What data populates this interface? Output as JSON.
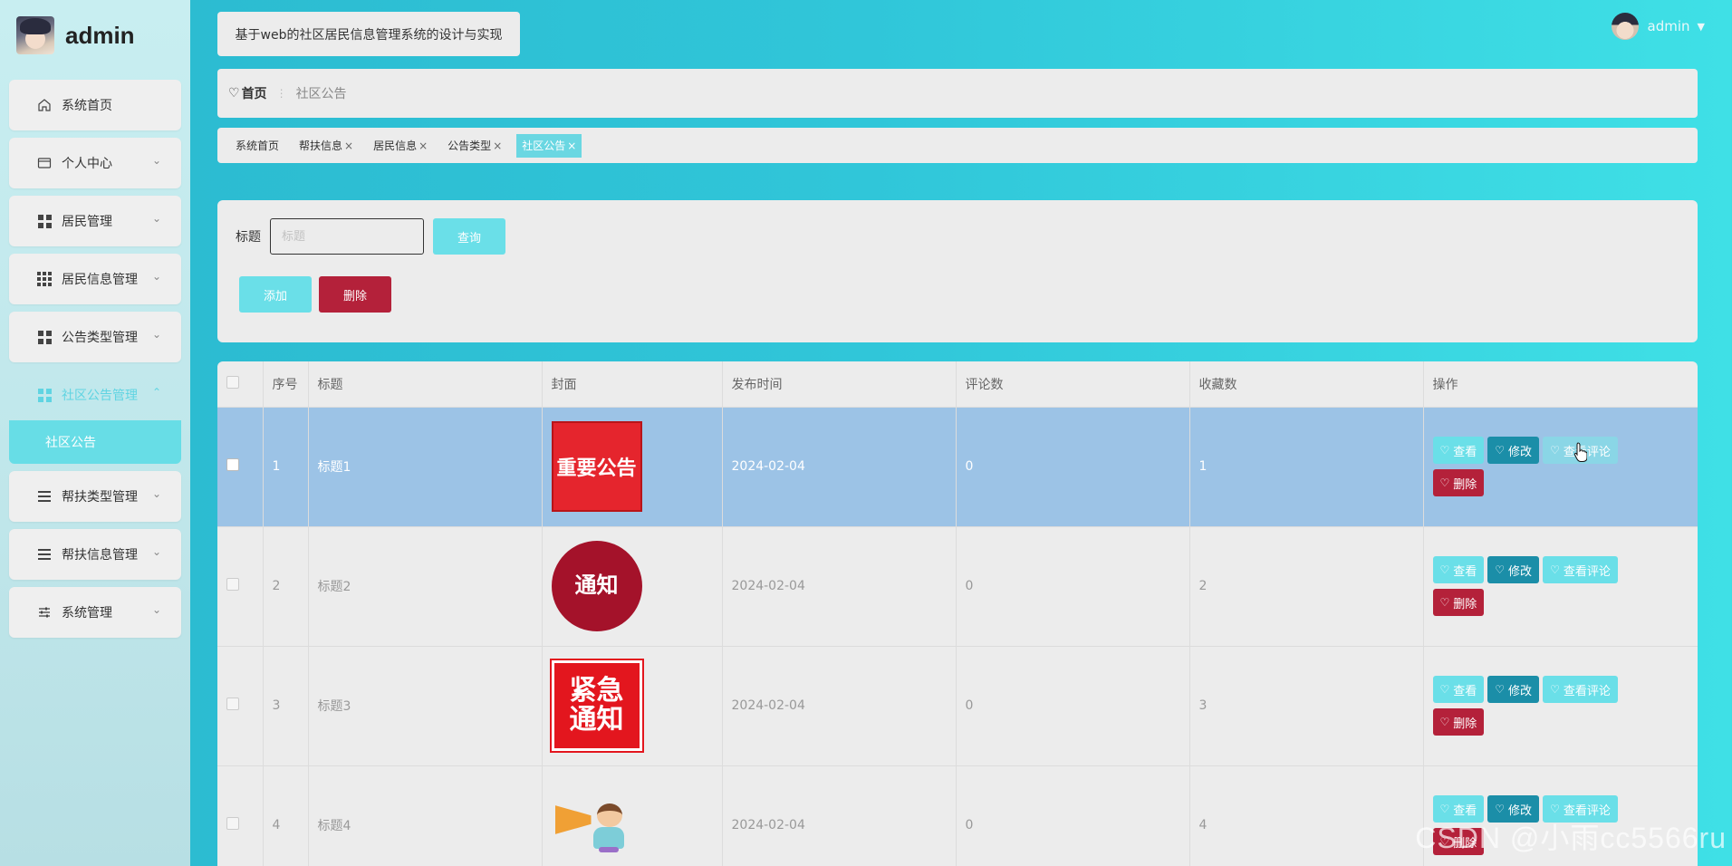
{
  "brand": {
    "title": "admin"
  },
  "sidebar": {
    "items": [
      {
        "label": "系统首页",
        "icon": "home-icon"
      },
      {
        "label": "个人中心",
        "icon": "card-icon"
      },
      {
        "label": "居民管理",
        "icon": "grid-icon"
      },
      {
        "label": "居民信息管理",
        "icon": "grid9-icon"
      },
      {
        "label": "公告类型管理",
        "icon": "grid-icon"
      },
      {
        "label": "社区公告管理",
        "icon": "grid-icon"
      },
      {
        "label": "帮扶类型管理",
        "icon": "list-icon"
      },
      {
        "label": "帮扶信息管理",
        "icon": "list-icon"
      },
      {
        "label": "系统管理",
        "icon": "sliders-icon"
      }
    ],
    "submenu": {
      "label": "社区公告"
    }
  },
  "header": {
    "site_title": "基于web的社区居民信息管理系统的设计与实现",
    "user_name": "admin"
  },
  "breadcrumb": {
    "home": "首页",
    "current": "社区公告"
  },
  "tags": [
    "系统首页",
    "帮扶信息",
    "居民信息",
    "公告类型",
    "社区公告"
  ],
  "search": {
    "label": "标题",
    "placeholder": "标题",
    "query_label": "查询",
    "add_label": "添加",
    "delete_label": "删除"
  },
  "table": {
    "columns": [
      "序号",
      "标题",
      "封面",
      "发布时间",
      "评论数",
      "收藏数",
      "操作"
    ],
    "actions": {
      "view": "查看",
      "edit": "修改",
      "comments": "查看评论",
      "delete": "删除"
    },
    "rows": [
      {
        "index": "1",
        "title": "标题1",
        "cover_text": "重要公告",
        "date": "2024-02-04",
        "comments": "0",
        "favorites": "1"
      },
      {
        "index": "2",
        "title": "标题2",
        "cover_text": "通知",
        "date": "2024-02-04",
        "comments": "0",
        "favorites": "2"
      },
      {
        "index": "3",
        "title": "标题3",
        "cover_text_1": "紧急",
        "cover_text_2": "通知",
        "date": "2024-02-04",
        "comments": "0",
        "favorites": "3"
      },
      {
        "index": "4",
        "title": "标题4",
        "date": "2024-02-04",
        "comments": "0",
        "favorites": "4"
      }
    ]
  },
  "watermark": "CSDN @小雨cc5566ru",
  "colors": {
    "accent": "#6adfe8",
    "edit": "#1b8ea8",
    "danger": "#b4213a",
    "selected_row": "#9cc3e6"
  }
}
